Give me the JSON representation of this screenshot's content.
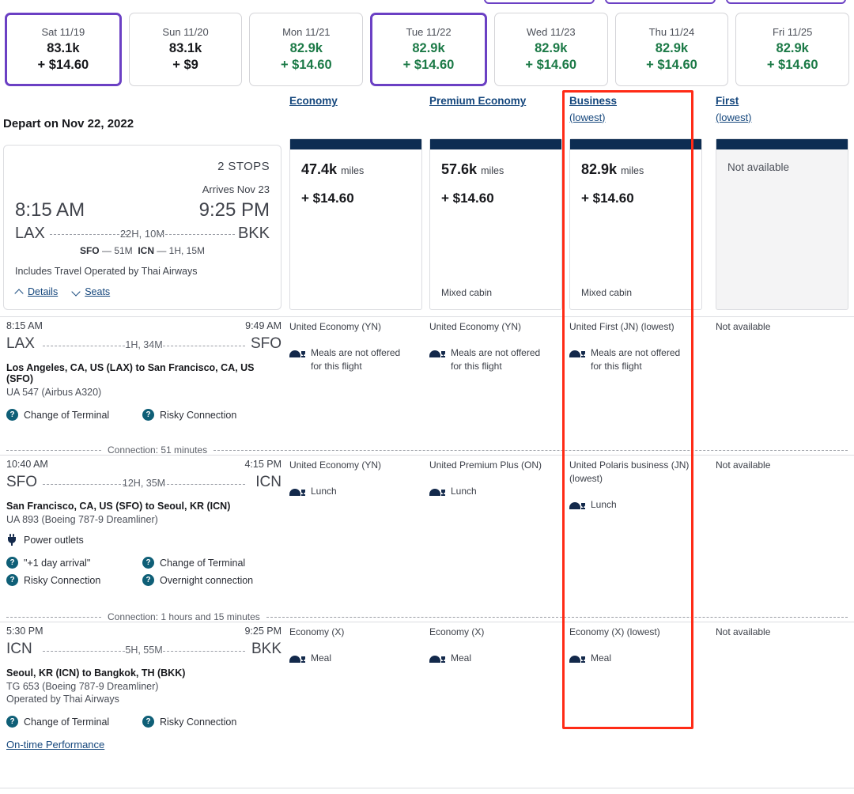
{
  "date_strip": {
    "items": [
      {
        "day": "Sat 11/19",
        "miles": "83.1k",
        "cash": "+ $14.60",
        "selected": true,
        "green": false
      },
      {
        "day": "Sun 11/20",
        "miles": "83.1k",
        "cash": "+ $9",
        "selected": false,
        "green": false
      },
      {
        "day": "Mon 11/21",
        "miles": "82.9k",
        "cash": "+ $14.60",
        "selected": false,
        "green": true
      },
      {
        "day": "Tue 11/22",
        "miles": "82.9k",
        "cash": "+ $14.60",
        "selected": true,
        "green": true
      },
      {
        "day": "Wed 11/23",
        "miles": "82.9k",
        "cash": "+ $14.60",
        "selected": false,
        "green": true
      },
      {
        "day": "Thu 11/24",
        "miles": "82.9k",
        "cash": "+ $14.60",
        "selected": false,
        "green": true
      },
      {
        "day": "Fri 11/25",
        "miles": "82.9k",
        "cash": "+ $14.60",
        "selected": false,
        "green": true
      }
    ]
  },
  "cabins": [
    {
      "label": "Economy",
      "sub": ""
    },
    {
      "label": "Premium Economy",
      "sub": ""
    },
    {
      "label": "Business",
      "sub": "(lowest)"
    },
    {
      "label": "First",
      "sub": "(lowest)"
    }
  ],
  "depart_title": "Depart on Nov 22, 2022",
  "summary": {
    "stops": "2 STOPS",
    "arrives": "Arrives Nov 23",
    "depart_time": "8:15 AM",
    "arrive_time": "9:25 PM",
    "origin": "LAX",
    "destination": "BKK",
    "duration": "22H, 10M",
    "stopover_1_code": "SFO",
    "stopover_1_dur": "51M",
    "stopover_2_code": "ICN",
    "stopover_2_dur": "1H, 15M",
    "operated_note": "Includes Travel Operated by Thai Airways",
    "details_label": "Details",
    "seats_label": "Seats"
  },
  "fares": [
    {
      "miles": "47.4k",
      "miles_unit": "miles",
      "cash": "+ $14.60",
      "mixed": "",
      "available": true
    },
    {
      "miles": "57.6k",
      "miles_unit": "miles",
      "cash": "+ $14.60",
      "mixed": "Mixed cabin",
      "available": true
    },
    {
      "miles": "82.9k",
      "miles_unit": "miles",
      "cash": "+ $14.60",
      "mixed": "Mixed cabin",
      "available": true
    },
    {
      "miles": "",
      "miles_unit": "",
      "cash": "",
      "mixed": "",
      "available": false,
      "na_label": "Not available"
    }
  ],
  "segments": [
    {
      "depart_time": "8:15 AM",
      "arrive_time": "9:49 AM",
      "origin": "LAX",
      "destination": "SFO",
      "duration": "1H, 34M",
      "route": "Los Angeles, CA, US (LAX) to San Francisco, CA, US (SFO)",
      "aircraft": "UA 547 (Airbus A320)",
      "operated_by": "",
      "amenities": [],
      "badges": [
        "Change of Terminal",
        "Risky Connection"
      ],
      "otp_link": "",
      "connection": "Connection: 51 minutes",
      "cells": [
        {
          "fare": "United Economy (YN)",
          "meal": "Meals are not offered for this flight"
        },
        {
          "fare": "United Economy (YN)",
          "meal": "Meals are not offered for this flight"
        },
        {
          "fare": "United First (JN) (lowest)",
          "meal": "Meals are not offered for this flight"
        },
        {
          "fare": "Not available",
          "meal": ""
        }
      ]
    },
    {
      "depart_time": "10:40 AM",
      "arrive_time": "4:15 PM",
      "origin": "SFO",
      "destination": "ICN",
      "duration": "12H, 35M",
      "route": "San Francisco, CA, US (SFO) to Seoul, KR (ICN)",
      "aircraft": "UA 893 (Boeing 787-9 Dreamliner)",
      "operated_by": "",
      "amenities": [
        "Power outlets"
      ],
      "badges": [
        "\"+1 day arrival\"",
        "Change of Terminal",
        "Risky Connection",
        "Overnight connection"
      ],
      "otp_link": "",
      "connection": "Connection: 1 hours and 15 minutes",
      "cells": [
        {
          "fare": "United Economy (YN)",
          "meal": "Lunch"
        },
        {
          "fare": "United Premium Plus (ON)",
          "meal": "Lunch"
        },
        {
          "fare": "United Polaris business (JN) (lowest)",
          "meal": "Lunch"
        },
        {
          "fare": "Not available",
          "meal": ""
        }
      ]
    },
    {
      "depart_time": "5:30 PM",
      "arrive_time": "9:25 PM",
      "origin": "ICN",
      "destination": "BKK",
      "duration": "5H, 55M",
      "route": "Seoul, KR (ICN) to Bangkok, TH (BKK)",
      "aircraft": "TG 653 (Boeing 787-9 Dreamliner)",
      "operated_by": "Operated by Thai Airways",
      "amenities": [],
      "badges": [
        "Change of Terminal",
        "Risky Connection"
      ],
      "otp_link": "On-time Performance",
      "connection": "",
      "cells": [
        {
          "fare": "Economy (X)",
          "meal": "Meal"
        },
        {
          "fare": "Economy (X)",
          "meal": "Meal"
        },
        {
          "fare": "Economy (X) (lowest)",
          "meal": "Meal"
        },
        {
          "fare": "Not available",
          "meal": ""
        }
      ]
    }
  ],
  "icons": {
    "help": "?",
    "meal": "meal-icon",
    "power": "power-outlet-icon"
  },
  "colors": {
    "accent_purple": "#6b40c4",
    "green": "#1c7a47",
    "link_blue": "#14467c",
    "fare_bar": "#0d2d52",
    "highlight_red": "#ff2b16",
    "help_icon": "#0f5f77"
  },
  "highlight": {
    "label": "business-column-highlight"
  }
}
